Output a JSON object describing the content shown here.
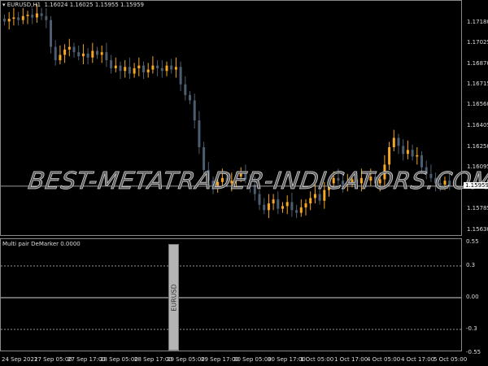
{
  "header": {
    "symbol": "EURUSD,H1",
    "ohlc": "1.16024 1.16025 1.15955 1.15959"
  },
  "price_axis": [
    "1.17180",
    "1.17025",
    "1.16870",
    "1.16715",
    "1.16560",
    "1.16405",
    "1.16250",
    "1.16095",
    "1.15785",
    "1.15630"
  ],
  "current_price": "1.15959",
  "watermark": "BEST-METATRADER-INDICATORS.COM",
  "indicator": {
    "title": "Multi pair DeMarker 0.0000",
    "levels": [
      "0.55",
      "0.3",
      "0.00",
      "-0.3",
      "-0.55"
    ],
    "pair_label": "EURUSD"
  },
  "time_axis": [
    "24 Sep 2021",
    "27 Sep 05:00",
    "27 Sep 17:00",
    "28 Sep 05:00",
    "28 Sep 17:00",
    "29 Sep 05:00",
    "29 Sep 17:00",
    "30 Sep 05:00",
    "30 Sep 17:00",
    "1 Oct 05:00",
    "1 Oct 17:00",
    "4 Oct 05:00",
    "4 Oct 17:00",
    "5 Oct 05:00"
  ],
  "colors": {
    "bull": "#f5a623",
    "bear": "#4d5d70",
    "grid": "#999"
  },
  "closes": [
    1.1719,
    1.1721,
    1.1722,
    1.172,
    1.1723,
    1.1724,
    1.1722,
    1.1725,
    1.1723,
    1.172,
    1.17,
    1.169,
    1.1694,
    1.1698,
    1.17,
    1.1696,
    1.1693,
    1.1695,
    1.1692,
    1.1697,
    1.1694,
    1.1696,
    1.169,
    1.1684,
    1.1686,
    1.1682,
    1.1685,
    1.168,
    1.1684,
    1.1686,
    1.1681,
    1.1683,
    1.1686,
    1.1684,
    1.1682,
    1.1686,
    1.1683,
    1.1685,
    1.1672,
    1.1664,
    1.166,
    1.1645,
    1.1625,
    1.1608,
    1.16,
    1.1596,
    1.1599,
    1.1602,
    1.1598,
    1.16,
    1.1603,
    1.1605,
    1.1601,
    1.1597,
    1.159,
    1.1582,
    1.1578,
    1.1583,
    1.1586,
    1.1579,
    1.1581,
    1.1584,
    1.1578,
    1.1576,
    1.158,
    1.1583,
    1.1587,
    1.159,
    1.1585,
    1.1593,
    1.1598,
    1.1602,
    1.16,
    1.1597,
    1.1599,
    1.1601,
    1.1598,
    1.1602,
    1.16,
    1.1603,
    1.1598,
    1.1601,
    1.1612,
    1.1625,
    1.1632,
    1.1626,
    1.162,
    1.1623,
    1.1618,
    1.1619,
    1.161,
    1.1605,
    1.1602,
    1.1598,
    1.1597,
    1.16,
    1.1596
  ]
}
